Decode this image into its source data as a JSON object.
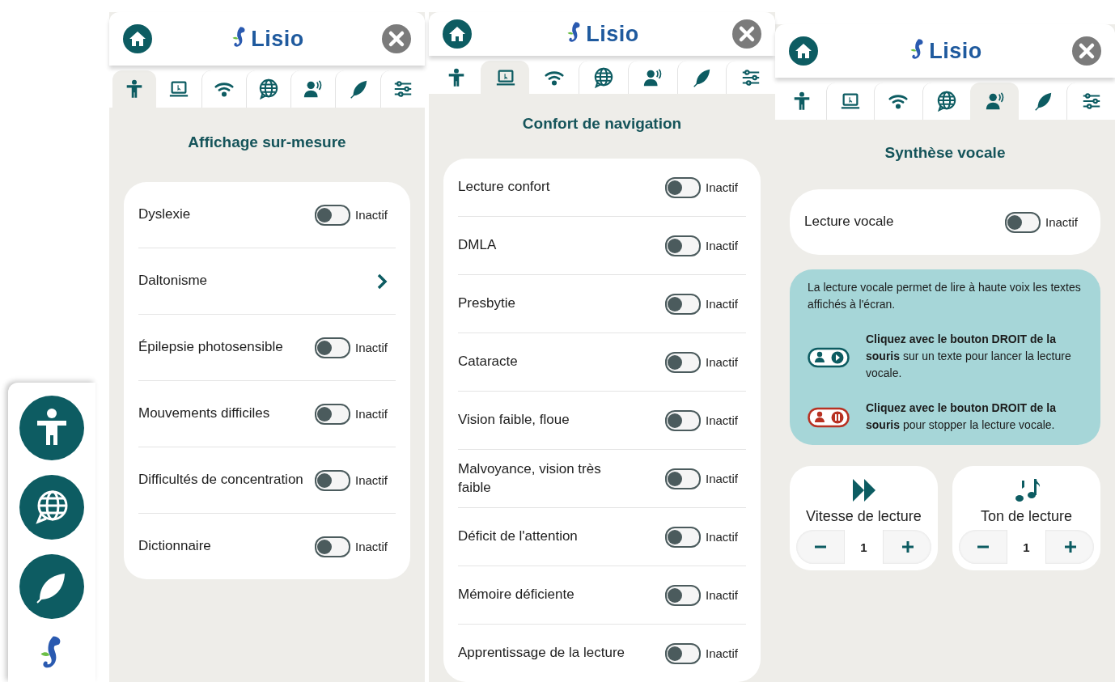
{
  "panels": [
    {
      "logo": "Lisio",
      "tabs": [
        {
          "kind": "accessibility",
          "selected": true
        },
        {
          "kind": "laptop",
          "selected": false
        },
        {
          "kind": "wifi",
          "selected": false
        },
        {
          "kind": "globe",
          "selected": false
        },
        {
          "kind": "voice",
          "selected": false
        },
        {
          "kind": "leaf",
          "selected": false
        },
        {
          "kind": "sliders",
          "selected": false
        }
      ],
      "heading": "Affichage sur-mesure",
      "items": [
        {
          "kind": "toggle",
          "label": "Dyslexie",
          "on": false,
          "status": "Inactif"
        },
        {
          "kind": "link",
          "label": "Daltonisme"
        },
        {
          "kind": "toggle",
          "label": "Épilepsie photosensible",
          "on": false,
          "status": "Inactif"
        },
        {
          "kind": "toggle",
          "label": "Mouvements difficiles",
          "on": false,
          "status": "Inactif"
        },
        {
          "kind": "toggle",
          "label": "Difficultés de concentration",
          "on": false,
          "status": "Inactif"
        },
        {
          "kind": "toggle",
          "label": "Dictionnaire",
          "on": false,
          "status": "Inactif"
        }
      ]
    },
    {
      "logo": "Lisio",
      "tabs": [
        {
          "kind": "accessibility",
          "selected": false
        },
        {
          "kind": "laptop",
          "selected": true
        },
        {
          "kind": "wifi",
          "selected": false
        },
        {
          "kind": "globe",
          "selected": false
        },
        {
          "kind": "voice",
          "selected": false
        },
        {
          "kind": "leaf",
          "selected": false
        },
        {
          "kind": "sliders",
          "selected": false
        }
      ],
      "heading": "Confort de navigation",
      "items": [
        {
          "kind": "toggle",
          "label": "Lecture confort",
          "on": false,
          "status": "Inactif"
        },
        {
          "kind": "toggle",
          "label": "DMLA",
          "on": false,
          "status": "Inactif"
        },
        {
          "kind": "toggle",
          "label": "Presbytie",
          "on": false,
          "status": "Inactif"
        },
        {
          "kind": "toggle",
          "label": "Cataracte",
          "on": false,
          "status": "Inactif"
        },
        {
          "kind": "toggle",
          "label": "Vision faible, floue",
          "on": false,
          "status": "Inactif"
        },
        {
          "kind": "toggle",
          "label": "Malvoyance, vision très faible",
          "on": false,
          "status": "Inactif"
        },
        {
          "kind": "toggle",
          "label": "Déficit de l'attention",
          "on": false,
          "status": "Inactif"
        },
        {
          "kind": "toggle",
          "label": "Mémoire déficiente",
          "on": false,
          "status": "Inactif"
        },
        {
          "kind": "toggle",
          "label": "Apprentissage de la lecture",
          "on": false,
          "status": "Inactif"
        }
      ]
    },
    {
      "logo": "Lisio",
      "tabs": [
        {
          "kind": "accessibility",
          "selected": false
        },
        {
          "kind": "laptop",
          "selected": false
        },
        {
          "kind": "wifi",
          "selected": false
        },
        {
          "kind": "globe",
          "selected": false
        },
        {
          "kind": "voice",
          "selected": true
        },
        {
          "kind": "leaf",
          "selected": false
        },
        {
          "kind": "sliders",
          "selected": false
        }
      ],
      "heading": "Synthèse vocale",
      "items": [
        {
          "kind": "toggle",
          "label": "Lecture vocale",
          "on": false,
          "status": "Inactif"
        }
      ],
      "info": {
        "intro": "La lecture vocale permet de lire à haute voix les textes affichés à l'écran.",
        "steps": [
          {
            "kind": "play",
            "text": "**Cliquez avec le bouton DROIT de la souris** sur un texte pour lancer la lecture vocale."
          },
          {
            "kind": "stop",
            "text": "**Cliquez avec le bouton DROIT de la souris** pour stopper la lecture vocale."
          }
        ]
      },
      "steppers": [
        {
          "kind": "speed",
          "label": "Vitesse de lecture",
          "value": "1"
        },
        {
          "kind": "pitch",
          "label": "Ton de lecture",
          "value": "1"
        }
      ]
    }
  ]
}
